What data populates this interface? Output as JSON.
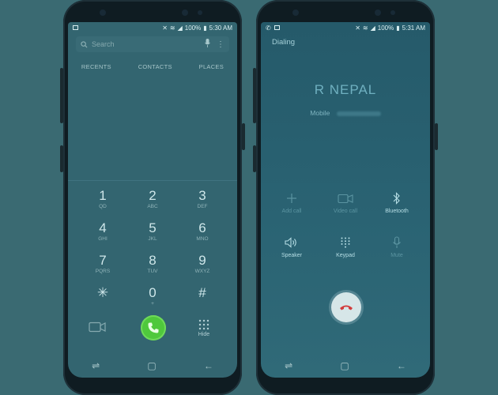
{
  "left_phone": {
    "status": {
      "battery": "100%",
      "time": "5:30 AM"
    },
    "search": {
      "placeholder": "Search"
    },
    "tabs": [
      "RECENTS",
      "CONTACTS",
      "PLACES"
    ],
    "keys": [
      {
        "num": "1",
        "letters": "QD"
      },
      {
        "num": "2",
        "letters": "ABC"
      },
      {
        "num": "3",
        "letters": "DEF"
      },
      {
        "num": "4",
        "letters": "GHI"
      },
      {
        "num": "5",
        "letters": "JKL"
      },
      {
        "num": "6",
        "letters": "MNO"
      },
      {
        "num": "7",
        "letters": "PQRS"
      },
      {
        "num": "8",
        "letters": "TUV"
      },
      {
        "num": "9",
        "letters": "WXYZ"
      },
      {
        "num": "✳",
        "letters": ""
      },
      {
        "num": "0",
        "letters": "+"
      },
      {
        "num": "#",
        "letters": ""
      }
    ],
    "hide_label": "Hide",
    "colors": {
      "call_button": "#4fc83c"
    }
  },
  "right_phone": {
    "status": {
      "battery": "100%",
      "time": "5:31 AM"
    },
    "state_label": "Dialing",
    "caller_name": "R NEPAL",
    "number_type": "Mobile",
    "controls": [
      {
        "label": "Add call",
        "icon": "plus-icon",
        "enabled": false
      },
      {
        "label": "Video call",
        "icon": "video-icon",
        "enabled": false
      },
      {
        "label": "Bluetooth",
        "icon": "bluetooth-icon",
        "enabled": true
      },
      {
        "label": "Speaker",
        "icon": "speaker-icon",
        "enabled": true
      },
      {
        "label": "Keypad",
        "icon": "keypad-icon",
        "enabled": true
      },
      {
        "label": "Mute",
        "icon": "mic-icon",
        "enabled": false
      }
    ],
    "colors": {
      "end_call_icon": "#d23c3c"
    }
  }
}
